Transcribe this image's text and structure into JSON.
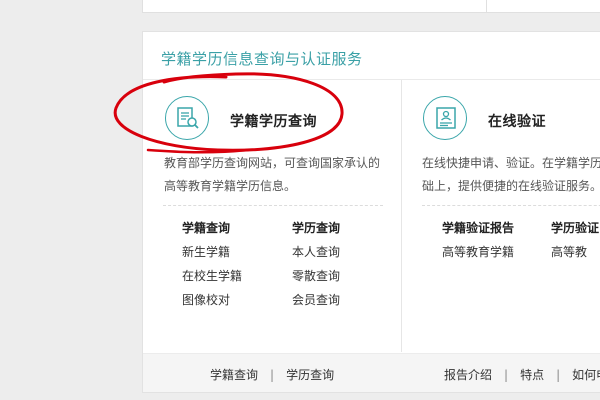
{
  "panel": {
    "title": "学籍学历信息查询与认证服务"
  },
  "left": {
    "name": "学籍学历查询",
    "desc_line1": "教育部学历查询网站，可查询国家承认的",
    "desc_line2": "高等教育学籍学历信息。",
    "col1": {
      "head": "学籍查询",
      "items": [
        "新生学籍",
        "在校生学籍",
        "图像校对"
      ]
    },
    "col2": {
      "head": "学历查询",
      "items": [
        "本人查询",
        "零散查询",
        "会员查询"
      ]
    },
    "footer": [
      "学籍查询",
      "学历查询"
    ]
  },
  "right": {
    "name": "在线验证",
    "desc_line1": "在线快捷申请、验证。在学籍学历",
    "desc_line2": "础上，提供便捷的在线验证服务。",
    "col1": {
      "head": "学籍验证报告",
      "items": [
        "高等教育学籍"
      ]
    },
    "col2": {
      "head": "学历验证",
      "items": [
        "高等教"
      ]
    },
    "footer": [
      "报告介绍",
      "特点",
      "如何申"
    ]
  },
  "colors": {
    "accent": "#3aa0a6",
    "annotation": "#d8000c"
  },
  "icons": {
    "left": "document-search-icon",
    "right": "certificate-icon"
  }
}
